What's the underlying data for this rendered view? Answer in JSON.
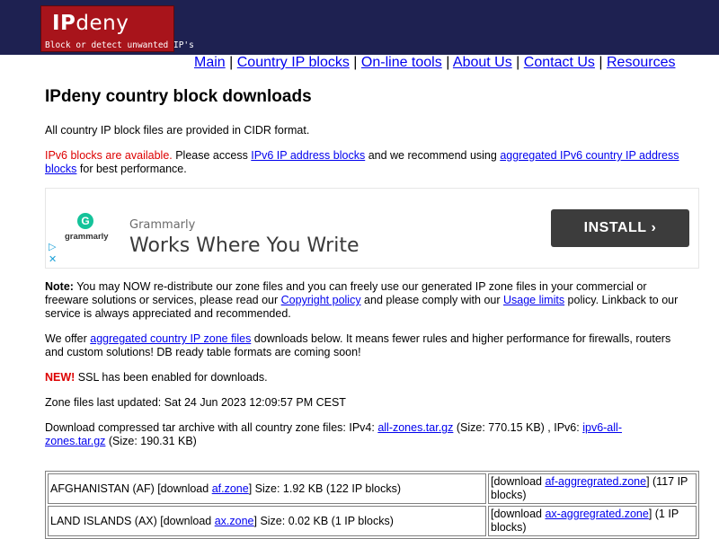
{
  "header": {
    "logo_brand_bold": "IP",
    "logo_brand_rest": "deny",
    "logo_tagline": "Block or detect unwanted IP's",
    "colors": {
      "bar": "#1e2151",
      "logo_bg": "#a8141b"
    }
  },
  "nav": {
    "items": [
      "Main",
      "Country IP blocks",
      "On-line tools",
      "About Us",
      "Contact Us",
      "Resources"
    ],
    "separator": "|"
  },
  "page": {
    "title": "IPdeny country block downloads",
    "cidr_text": "All country IP block files are provided in CIDR format.",
    "ipv6": {
      "alert": "IPv6 blocks are available.",
      "text1": " Please access ",
      "link1": "IPv6 IP address blocks",
      "text2": " and we recommend using ",
      "link2": "aggregated IPv6 country IP address blocks",
      "text3": " for best performance."
    },
    "note": {
      "label": "Note:",
      "text1": " You may NOW re-distribute our zone files and you can freely use our generated IP zone files in your commercial or freeware solutions or services, please read our ",
      "link1": "Copyright policy",
      "text2": " and please comply with our ",
      "link2": "Usage limits",
      "text3": " policy. Linkback to our service is always appreciated and recommended."
    },
    "offer": {
      "text1": "We offer ",
      "link": "aggregated country IP zone files",
      "text2": " downloads below. It means fewer rules and higher performance for firewalls, routers and custom solutions! DB ready table formats are coming soon!"
    },
    "ssl": {
      "label": "NEW!",
      "text": " SSL has been enabled for downloads."
    },
    "updated": "Zone files last updated: Sat 24 Jun 2023 12:09:57 PM CEST",
    "download_all": {
      "text1": "Download compressed tar archive with all country zone files: IPv4: ",
      "link1": "all-zones.tar.gz",
      "text2": " (Size: 770.15 KB) , IPv6: ",
      "link2": "ipv6-all-zones.tar.gz",
      "text3": " (Size: 190.31 KB)"
    }
  },
  "ad": {
    "brand": "Grammarly",
    "logo_text": "grammarly",
    "logo_letter": "G",
    "headline": "Works Where You Write",
    "button": "INSTALL",
    "button_chevron": "›",
    "adchoices_icon": "▷",
    "close_icon": "✕",
    "colors": {
      "button_bg": "#3c3c3c",
      "logo": "#15c39a"
    }
  },
  "zones": [
    {
      "country_text": "AFGHANISTAN (AF) [download ",
      "zone_link": "af.zone",
      "size_text": "] Size: 1.92 KB (122 IP blocks)",
      "agg_pre": "[download ",
      "agg_link": "af-aggregrated.zone",
      "agg_post": "] (117 IP blocks)"
    },
    {
      "country_text": "LAND ISLANDS (AX) [download ",
      "zone_link": "ax.zone",
      "size_text": "] Size: 0.02 KB (1 IP blocks)",
      "agg_pre": "[download ",
      "agg_link": "ax-aggregrated.zone",
      "agg_post": "] (1 IP blocks)"
    }
  ]
}
